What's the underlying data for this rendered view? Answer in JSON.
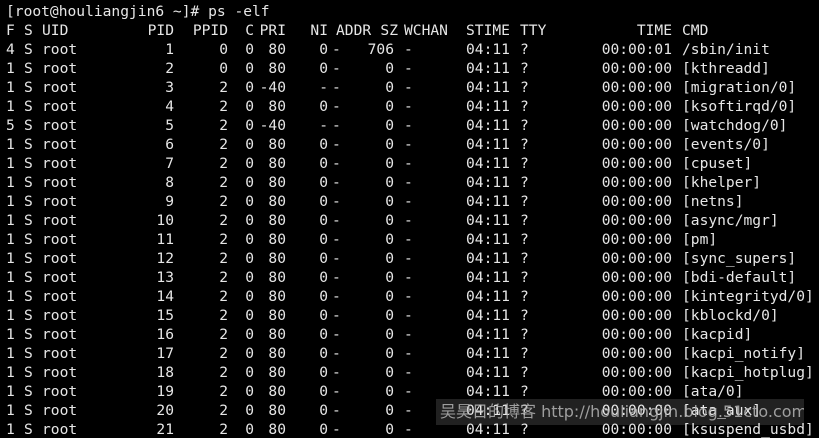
{
  "terminal": {
    "prompt": "[root@houliangjin6 ~]# ps -elf",
    "headers": {
      "f": "F",
      "s": "S",
      "uid": "UID",
      "pid": "PID",
      "ppid": "PPID",
      "c": "C",
      "pri": "PRI",
      "ni": "NI",
      "addr": "ADDR",
      "sz": "SZ",
      "wchan": "WCHAN",
      "stime": "STIME",
      "tty": "TTY",
      "time": "TIME",
      "cmd": "CMD"
    },
    "rows": [
      {
        "f": "4",
        "s": "S",
        "uid": "root",
        "pid": "1",
        "ppid": "0",
        "c": "0",
        "pri": "80",
        "ni": "0",
        "addr": "-",
        "sz": "706",
        "wchan": "-",
        "stime": "04:11",
        "tty": "?",
        "time": "00:00:01",
        "cmd": "/sbin/init"
      },
      {
        "f": "1",
        "s": "S",
        "uid": "root",
        "pid": "2",
        "ppid": "0",
        "c": "0",
        "pri": "80",
        "ni": "0",
        "addr": "-",
        "sz": "0",
        "wchan": "-",
        "stime": "04:11",
        "tty": "?",
        "time": "00:00:00",
        "cmd": "[kthreadd]"
      },
      {
        "f": "1",
        "s": "S",
        "uid": "root",
        "pid": "3",
        "ppid": "2",
        "c": "0",
        "pri": "-40",
        "ni": "-",
        "addr": "-",
        "sz": "0",
        "wchan": "-",
        "stime": "04:11",
        "tty": "?",
        "time": "00:00:00",
        "cmd": "[migration/0]"
      },
      {
        "f": "1",
        "s": "S",
        "uid": "root",
        "pid": "4",
        "ppid": "2",
        "c": "0",
        "pri": "80",
        "ni": "0",
        "addr": "-",
        "sz": "0",
        "wchan": "-",
        "stime": "04:11",
        "tty": "?",
        "time": "00:00:00",
        "cmd": "[ksoftirqd/0]"
      },
      {
        "f": "5",
        "s": "S",
        "uid": "root",
        "pid": "5",
        "ppid": "2",
        "c": "0",
        "pri": "-40",
        "ni": "-",
        "addr": "-",
        "sz": "0",
        "wchan": "-",
        "stime": "04:11",
        "tty": "?",
        "time": "00:00:00",
        "cmd": "[watchdog/0]"
      },
      {
        "f": "1",
        "s": "S",
        "uid": "root",
        "pid": "6",
        "ppid": "2",
        "c": "0",
        "pri": "80",
        "ni": "0",
        "addr": "-",
        "sz": "0",
        "wchan": "-",
        "stime": "04:11",
        "tty": "?",
        "time": "00:00:00",
        "cmd": "[events/0]"
      },
      {
        "f": "1",
        "s": "S",
        "uid": "root",
        "pid": "7",
        "ppid": "2",
        "c": "0",
        "pri": "80",
        "ni": "0",
        "addr": "-",
        "sz": "0",
        "wchan": "-",
        "stime": "04:11",
        "tty": "?",
        "time": "00:00:00",
        "cmd": "[cpuset]"
      },
      {
        "f": "1",
        "s": "S",
        "uid": "root",
        "pid": "8",
        "ppid": "2",
        "c": "0",
        "pri": "80",
        "ni": "0",
        "addr": "-",
        "sz": "0",
        "wchan": "-",
        "stime": "04:11",
        "tty": "?",
        "time": "00:00:00",
        "cmd": "[khelper]"
      },
      {
        "f": "1",
        "s": "S",
        "uid": "root",
        "pid": "9",
        "ppid": "2",
        "c": "0",
        "pri": "80",
        "ni": "0",
        "addr": "-",
        "sz": "0",
        "wchan": "-",
        "stime": "04:11",
        "tty": "?",
        "time": "00:00:00",
        "cmd": "[netns]"
      },
      {
        "f": "1",
        "s": "S",
        "uid": "root",
        "pid": "10",
        "ppid": "2",
        "c": "0",
        "pri": "80",
        "ni": "0",
        "addr": "-",
        "sz": "0",
        "wchan": "-",
        "stime": "04:11",
        "tty": "?",
        "time": "00:00:00",
        "cmd": "[async/mgr]"
      },
      {
        "f": "1",
        "s": "S",
        "uid": "root",
        "pid": "11",
        "ppid": "2",
        "c": "0",
        "pri": "80",
        "ni": "0",
        "addr": "-",
        "sz": "0",
        "wchan": "-",
        "stime": "04:11",
        "tty": "?",
        "time": "00:00:00",
        "cmd": "[pm]"
      },
      {
        "f": "1",
        "s": "S",
        "uid": "root",
        "pid": "12",
        "ppid": "2",
        "c": "0",
        "pri": "80",
        "ni": "0",
        "addr": "-",
        "sz": "0",
        "wchan": "-",
        "stime": "04:11",
        "tty": "?",
        "time": "00:00:00",
        "cmd": "[sync_supers]"
      },
      {
        "f": "1",
        "s": "S",
        "uid": "root",
        "pid": "13",
        "ppid": "2",
        "c": "0",
        "pri": "80",
        "ni": "0",
        "addr": "-",
        "sz": "0",
        "wchan": "-",
        "stime": "04:11",
        "tty": "?",
        "time": "00:00:00",
        "cmd": "[bdi-default]"
      },
      {
        "f": "1",
        "s": "S",
        "uid": "root",
        "pid": "14",
        "ppid": "2",
        "c": "0",
        "pri": "80",
        "ni": "0",
        "addr": "-",
        "sz": "0",
        "wchan": "-",
        "stime": "04:11",
        "tty": "?",
        "time": "00:00:00",
        "cmd": "[kintegrityd/0]"
      },
      {
        "f": "1",
        "s": "S",
        "uid": "root",
        "pid": "15",
        "ppid": "2",
        "c": "0",
        "pri": "80",
        "ni": "0",
        "addr": "-",
        "sz": "0",
        "wchan": "-",
        "stime": "04:11",
        "tty": "?",
        "time": "00:00:00",
        "cmd": "[kblockd/0]"
      },
      {
        "f": "1",
        "s": "S",
        "uid": "root",
        "pid": "16",
        "ppid": "2",
        "c": "0",
        "pri": "80",
        "ni": "0",
        "addr": "-",
        "sz": "0",
        "wchan": "-",
        "stime": "04:11",
        "tty": "?",
        "time": "00:00:00",
        "cmd": "[kacpid]"
      },
      {
        "f": "1",
        "s": "S",
        "uid": "root",
        "pid": "17",
        "ppid": "2",
        "c": "0",
        "pri": "80",
        "ni": "0",
        "addr": "-",
        "sz": "0",
        "wchan": "-",
        "stime": "04:11",
        "tty": "?",
        "time": "00:00:00",
        "cmd": "[kacpi_notify]"
      },
      {
        "f": "1",
        "s": "S",
        "uid": "root",
        "pid": "18",
        "ppid": "2",
        "c": "0",
        "pri": "80",
        "ni": "0",
        "addr": "-",
        "sz": "0",
        "wchan": "-",
        "stime": "04:11",
        "tty": "?",
        "time": "00:00:00",
        "cmd": "[kacpi_hotplug]"
      },
      {
        "f": "1",
        "s": "S",
        "uid": "root",
        "pid": "19",
        "ppid": "2",
        "c": "0",
        "pri": "80",
        "ni": "0",
        "addr": "-",
        "sz": "0",
        "wchan": "-",
        "stime": "04:11",
        "tty": "?",
        "time": "00:00:00",
        "cmd": "[ata/0]"
      },
      {
        "f": "1",
        "s": "S",
        "uid": "root",
        "pid": "20",
        "ppid": "2",
        "c": "0",
        "pri": "80",
        "ni": "0",
        "addr": "-",
        "sz": "0",
        "wchan": "-",
        "stime": "04:11",
        "tty": "?",
        "time": "00:00:00",
        "cmd": "[ata_aux]"
      },
      {
        "f": "1",
        "s": "S",
        "uid": "root",
        "pid": "21",
        "ppid": "2",
        "c": "0",
        "pri": "80",
        "ni": "0",
        "addr": "-",
        "sz": "0",
        "wchan": "-",
        "stime": "04:11",
        "tty": "?",
        "time": "00:00:00",
        "cmd": "[ksuspend_usbd]"
      }
    ]
  },
  "watermark": {
    "text": "吴昊日的博客 http://houliangjin.blog.51cto.com"
  }
}
